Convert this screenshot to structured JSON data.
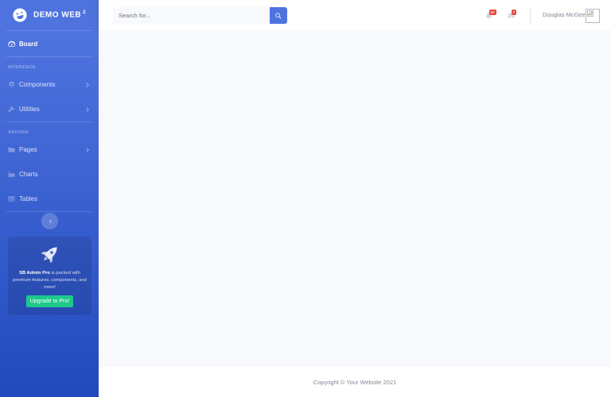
{
  "brand": {
    "name": "Demo Web",
    "superscript": "2"
  },
  "sidebar": {
    "board": "Board",
    "heading_interface": "Interface",
    "components": "Components",
    "utilities": "Utilities",
    "heading_addons": "Addons",
    "pages": "Pages",
    "charts": "Charts",
    "tables": "Tables"
  },
  "promo": {
    "strong": "SB Admin Pro",
    "text": " is packed with premium features, components, and more!",
    "button": "Upgrade to Pro!"
  },
  "topbar": {
    "search_placeholder": "Search for...",
    "alerts_badge": "3+",
    "messages_badge": "7",
    "user_name": "Douglas McGee"
  },
  "footer": {
    "copyright": "Copyright © Your Website 2021"
  },
  "colors": {
    "primary": "#4e73df",
    "success": "#1cc88a",
    "danger": "#e74a3b"
  }
}
